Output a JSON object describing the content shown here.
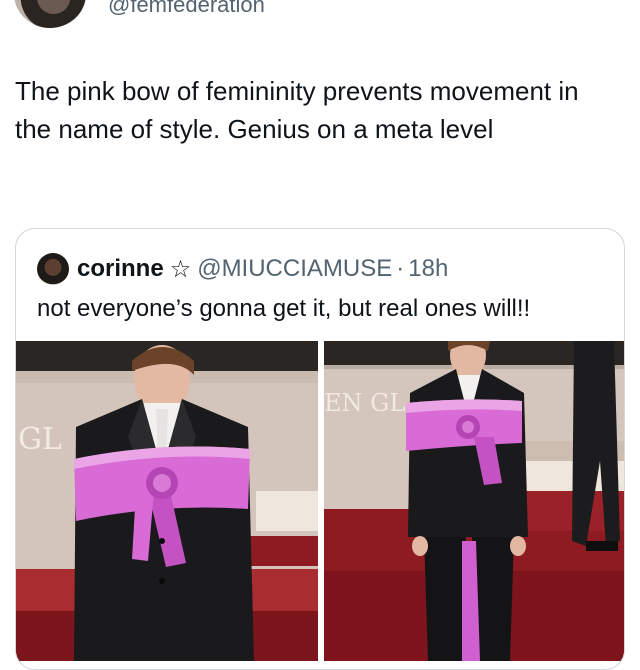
{
  "author": {
    "handle": "@femfederation"
  },
  "tweet": {
    "text": "The pink bow of femininity prevents movement in the name of style. Genius on a meta level"
  },
  "quoted_tweet": {
    "name": "corinne",
    "badge_icon": "star-outline-icon",
    "star_glyph": "☆",
    "handle": "@MIUCCIAMUSE",
    "separator": "·",
    "time": "18h",
    "text": "not everyone’s gonna get it, but real ones will!!",
    "photos": [
      {
        "backdrop_text": "GL"
      },
      {
        "backdrop_text": "EN GL"
      }
    ]
  },
  "colors": {
    "text_primary": "#0f1419",
    "text_secondary": "#536471",
    "border": "#cfd9de",
    "sash_pink": "#d96bd6",
    "carpet_red": "#8e1a22",
    "suit_black": "#1a1a1c"
  }
}
